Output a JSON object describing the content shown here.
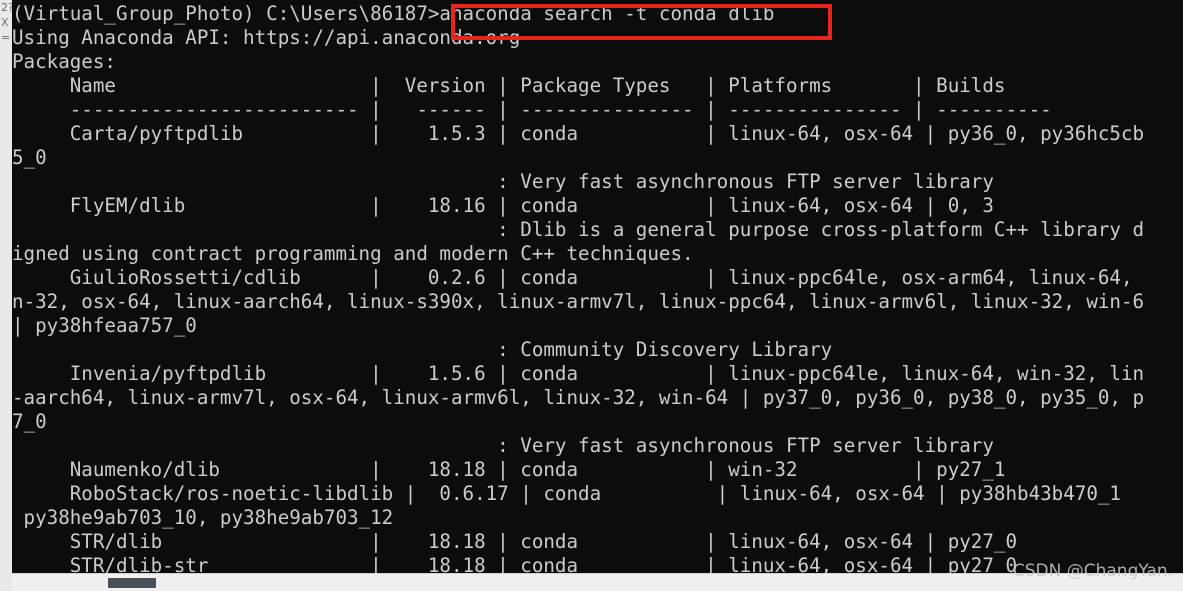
{
  "window": {
    "background_window_glyphs": [
      "2?",
      "X",
      "="
    ],
    "watermark": "CSDN @ChangYan."
  },
  "terminal": {
    "prompt": "(Virtual_Group_Photo) C:\\Users\\86187>",
    "command": "anaconda search -t conda dlib",
    "highlight_color": "#e8241c",
    "text_color": "#ccccc8",
    "background_color": "#0c0c0c",
    "lines": [
      "(Virtual_Group_Photo) C:\\Users\\86187>anaconda search -t conda dlib",
      "Using Anaconda API: https://api.anaconda.org",
      "Packages:",
      "     Name                      |  Version | Package Types   | Platforms       | Builds",
      "     ------------------------- |   ------ | --------------- | --------------- | ----------",
      "     Carta/pyftpdlib           |    1.5.3 | conda           | linux-64, osx-64 | py36_0, py36hc5cb",
      "5_0",
      "                                          : Very fast asynchronous FTP server library",
      "     FlyEM/dlib                |    18.16 | conda           | linux-64, osx-64 | 0, 3",
      "                                          : Dlib is a general purpose cross-platform C++ library d",
      "igned using contract programming and modern C++ techniques.",
      "     GiulioRossetti/cdlib      |    0.2.6 | conda           | linux-ppc64le, osx-arm64, linux-64,",
      "n-32, osx-64, linux-aarch64, linux-s390x, linux-armv7l, linux-ppc64, linux-armv6l, linux-32, win-6",
      "| py38hfeaa757_0",
      "                                          : Community Discovery Library",
      "     Invenia/pyftpdlib         |    1.5.6 | conda           | linux-ppc64le, linux-64, win-32, lin",
      "-aarch64, linux-armv7l, osx-64, linux-armv6l, linux-32, win-64 | py37_0, py36_0, py38_0, py35_0, p",
      "7_0",
      "                                          : Very fast asynchronous FTP server library",
      "     Naumenko/dlib             |    18.18 | conda           | win-32          | py27_1",
      "     RoboStack/ros-noetic-libdlib |  0.6.17 | conda          | linux-64, osx-64 | py38hb43b470_1",
      " py38he9ab703_10, py38he9ab703_12",
      "     STR/dlib                  |    18.18 | conda           | linux-64, osx-64 | py27_0",
      "     STR/dlib-str              |    18.18 | conda           | linux-64, osx-64 | py27_0"
    ]
  }
}
